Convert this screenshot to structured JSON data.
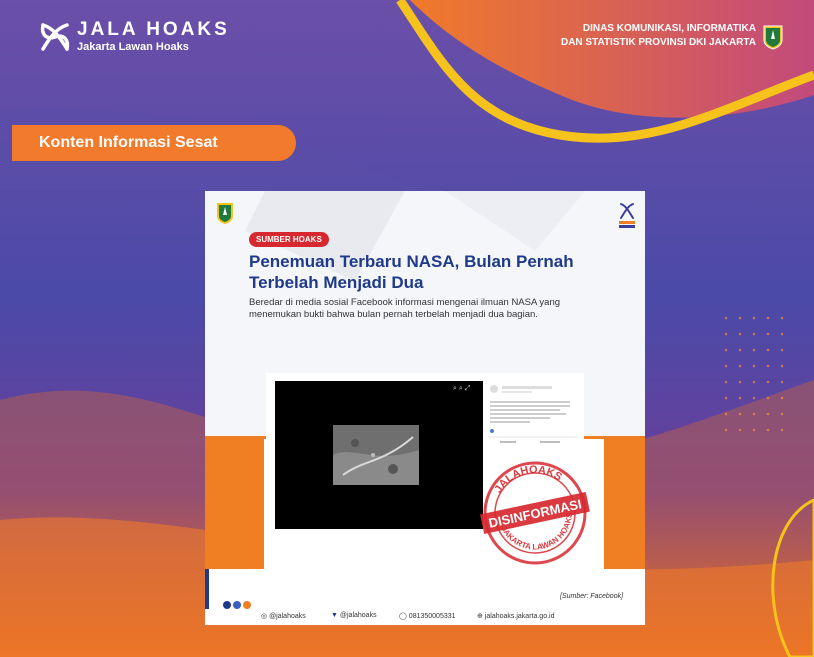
{
  "header": {
    "logo_title": "JALA HOAKS",
    "logo_subtitle": "Jakarta Lawan Hoaks",
    "dept_line1": "DINAS KOMUNIKASI, INFORMATIKA",
    "dept_line2": "DAN STATISTIK PROVINSI DKI JAKARTA"
  },
  "label": "Konten Informasi Sesat",
  "card": {
    "badge": "SUMBER HOAKS",
    "headline": "Penemuan Terbaru NASA, Bulan Pernah Terbelah Menjadi Dua",
    "body": "Beredar di media sosial Facebook informasi mengenai ilmuan NASA yang menemukan bukti bahwa bulan pernah terbelah menjadi dua bagian.",
    "source": "[Sumber: Facebook]",
    "stamp_top": "JALAHOAKS",
    "stamp_main": "DISINFORMASI",
    "stamp_bottom": "JAKARTA LAWAN HOAKS",
    "logo_small": "JALA HOAKS"
  },
  "social": {
    "instagram": "@jalahoaks",
    "twitter": "@jalahoaks",
    "whatsapp": "081350005331",
    "website": "jalahoaks.jakarta.go.id"
  },
  "colors": {
    "orange": "#f27a2c",
    "purple": "#3b3f9a",
    "yellow": "#f6c21c",
    "navy": "#1f3a8a",
    "red": "#d7282f"
  }
}
